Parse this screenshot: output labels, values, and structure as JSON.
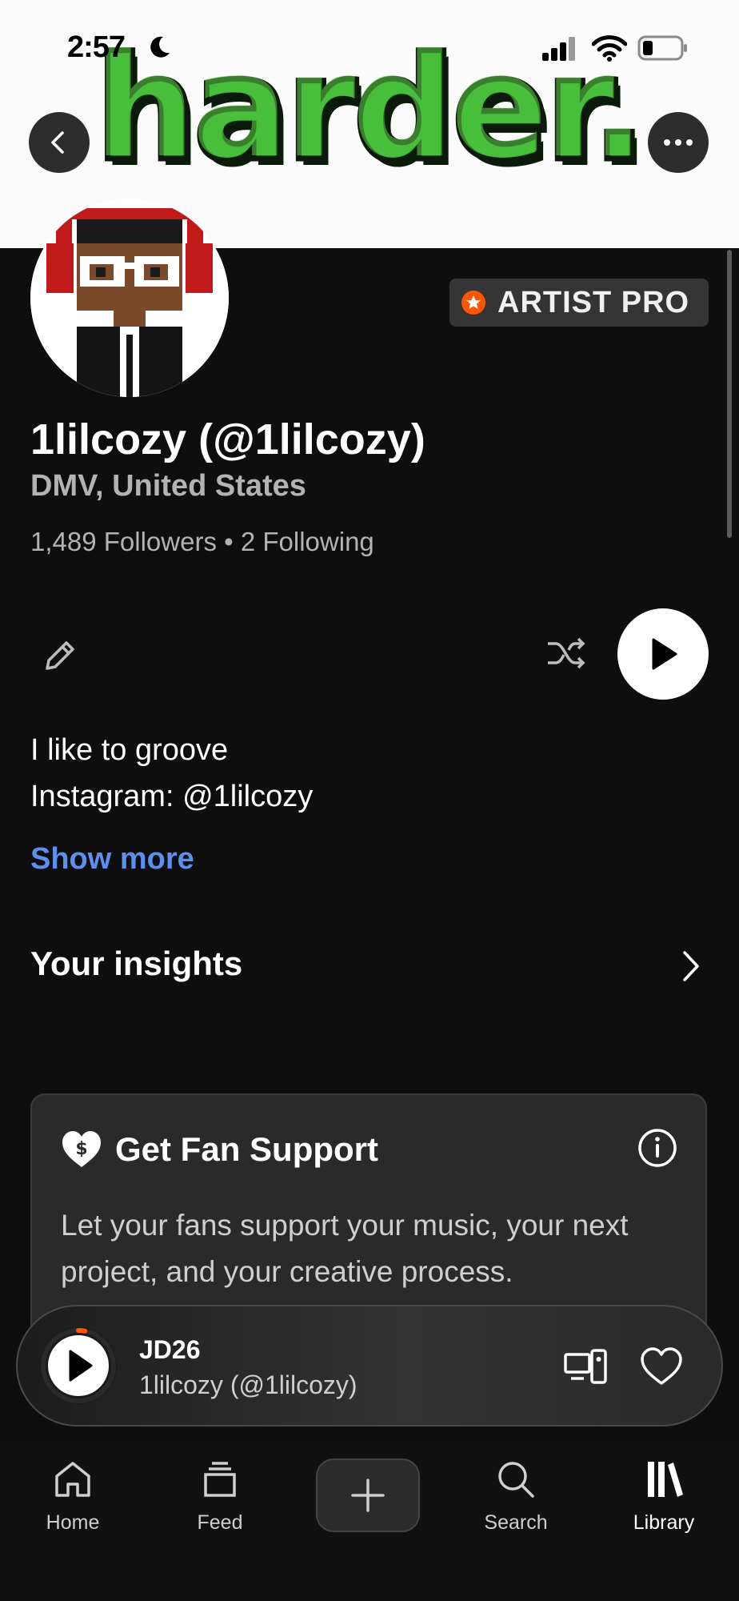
{
  "status_bar": {
    "time": "2:57"
  },
  "banner": {
    "logo_text": "harder."
  },
  "profile": {
    "badge": "ARTIST PRO",
    "name": "1lilcozy (@1lilcozy)",
    "location": "DMV, United States",
    "followers": "1,489 Followers",
    "separator": "•",
    "following": "2 Following"
  },
  "bio": {
    "line1": "I like to groove",
    "line2": "Instagram: @1lilcozy",
    "show_more": "Show more"
  },
  "insights": {
    "label": "Your insights"
  },
  "fan_support": {
    "title": "Get Fan Support",
    "description": "Let your fans support your music, your next project, and your creative process."
  },
  "now_playing": {
    "title": "JD26",
    "artist": "1lilcozy (@1lilcozy)",
    "progress": 0.03
  },
  "tabs": [
    {
      "label": "Home",
      "icon": "home-icon"
    },
    {
      "label": "Feed",
      "icon": "feed-icon"
    },
    {
      "label": "",
      "icon": "plus-icon"
    },
    {
      "label": "Search",
      "icon": "search-icon"
    },
    {
      "label": "Library",
      "icon": "library-icon"
    }
  ],
  "colors": {
    "accent_link": "#5d8fef",
    "badge_star": "#ff5500",
    "logo_green": "#2ea82a",
    "background": "#0e0e0f"
  }
}
